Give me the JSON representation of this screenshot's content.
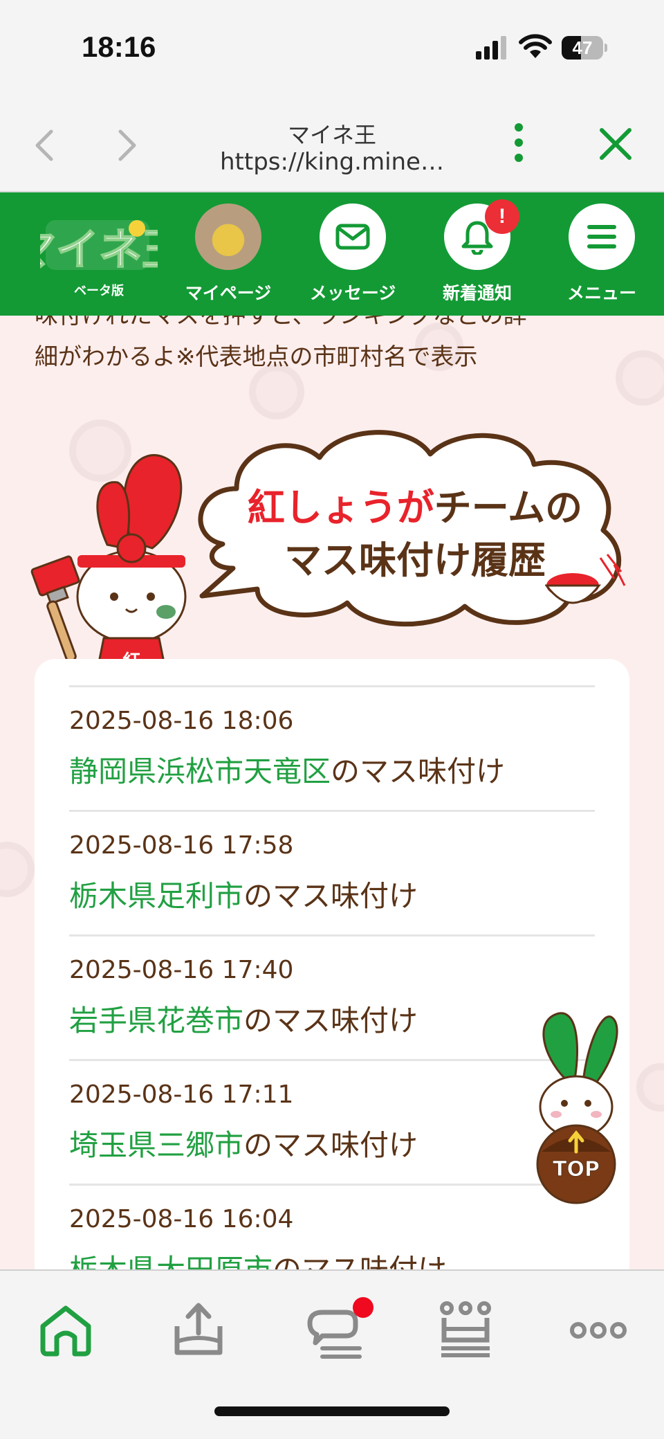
{
  "status": {
    "time": "18:16",
    "battery": "47",
    "battery_level": 0.47
  },
  "browser": {
    "title": "マイネ王",
    "url": "https://king.mine…"
  },
  "header": {
    "logo_alt": "マイネ王",
    "logo_sub": "ベータ版",
    "nav": [
      {
        "label": "マイページ",
        "icon": "avatar"
      },
      {
        "label": "メッセージ",
        "icon": "envelope-icon"
      },
      {
        "label": "新着通知",
        "icon": "bell-icon",
        "badge": "!"
      },
      {
        "label": "メニュー",
        "icon": "hamburger-icon"
      }
    ]
  },
  "intro": {
    "line1": "味付けれたマスを押すと、ランキングなどの詳",
    "line2": "細がわかるよ※代表地点の市町村名で表示"
  },
  "section": {
    "title_red": "紅しょうが",
    "title_rest": "チームの",
    "title_line2": "マス味付け履歴",
    "mascot_label": "紅"
  },
  "history": [
    {
      "date": "2025-08-16 18:06",
      "place": "静岡県浜松市天竜区",
      "suffix": "のマス味付け"
    },
    {
      "date": "2025-08-16 17:58",
      "place": "栃木県足利市",
      "suffix": "のマス味付け"
    },
    {
      "date": "2025-08-16 17:40",
      "place": "岩手県花巻市",
      "suffix": "のマス味付け"
    },
    {
      "date": "2025-08-16 17:11",
      "place": "埼玉県三郷市",
      "suffix": "のマス味付け"
    },
    {
      "date": "2025-08-16 16:04",
      "place": "栃木県大田原市",
      "suffix": "のマス味付け"
    }
  ],
  "top_button": "TOP",
  "tabbar": [
    "home-icon",
    "upload-icon",
    "chat-icon",
    "crown-icon",
    "more-icon"
  ],
  "colors": {
    "brand_green": "#139a35",
    "place_green": "#21a042",
    "brown": "#5a3317",
    "accent_red": "#e8232b",
    "bg_pink": "#fdeeee"
  }
}
